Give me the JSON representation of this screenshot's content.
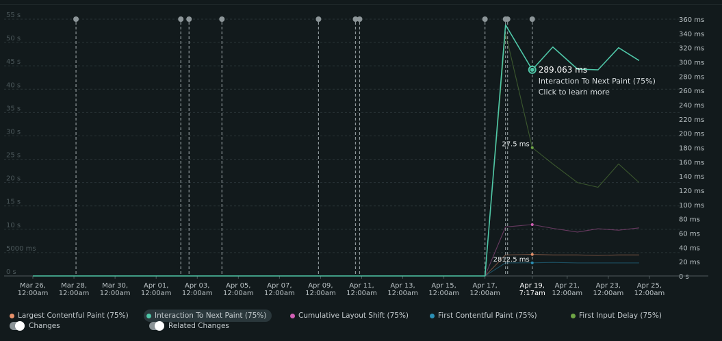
{
  "chart_data": {
    "type": "line",
    "x_ticks": [
      {
        "line1": "Mar 26,",
        "line2": "12:00am"
      },
      {
        "line1": "Mar 28,",
        "line2": "12:00am"
      },
      {
        "line1": "Mar 30,",
        "line2": "12:00am"
      },
      {
        "line1": "Apr 01,",
        "line2": "12:00am"
      },
      {
        "line1": "Apr 03,",
        "line2": "12:00am"
      },
      {
        "line1": "Apr 05,",
        "line2": "12:00am"
      },
      {
        "line1": "Apr 07,",
        "line2": "12:00am"
      },
      {
        "line1": "Apr 09,",
        "line2": "12:00am"
      },
      {
        "line1": "Apr 11,",
        "line2": "12:00am"
      },
      {
        "line1": "Apr 13,",
        "line2": "12:00am"
      },
      {
        "line1": "Apr 15,",
        "line2": "12:00am"
      },
      {
        "line1": "Apr 17,",
        "line2": "12:00am"
      },
      {
        "line1": "Apr 19,",
        "line2": "7:17am",
        "highlight": true
      },
      {
        "line1": "Apr 21,",
        "line2": "12:00am"
      },
      {
        "line1": "Apr 23,",
        "line2": "12:00am"
      },
      {
        "line1": "Apr 25,",
        "line2": "12:00am"
      }
    ],
    "x_tick_days": [
      0,
      2,
      4,
      6,
      8,
      10,
      12,
      14,
      16,
      18,
      20,
      22,
      24.3,
      26,
      28,
      30
    ],
    "left_axis": {
      "ticks": [
        "55 s",
        "50 s",
        "45 s",
        "40 s",
        "35 s",
        "30 s",
        "25 s",
        "20 s",
        "15 s",
        "10 s",
        "5000 ms",
        "0 s"
      ],
      "values": [
        55,
        50,
        45,
        40,
        35,
        30,
        25,
        20,
        15,
        10,
        5,
        0
      ],
      "ylim": [
        0,
        55
      ]
    },
    "right_axis": {
      "ticks": [
        "360 ms",
        "340 ms",
        "320 ms",
        "300 ms",
        "280 ms",
        "260 ms",
        "240 ms",
        "220 ms",
        "200 ms",
        "180 ms",
        "160 ms",
        "140 ms",
        "120 ms",
        "100 ms",
        "80 ms",
        "60 ms",
        "40 ms",
        "20 ms",
        "0 s"
      ],
      "values": [
        360,
        340,
        320,
        300,
        280,
        260,
        240,
        220,
        200,
        180,
        160,
        140,
        120,
        100,
        80,
        60,
        40,
        20,
        0
      ],
      "ylim": [
        0,
        360
      ]
    },
    "grid": true,
    "change_marker_days": [
      2.1,
      7.2,
      7.6,
      9.2,
      13.9,
      15.7,
      15.9,
      22.0,
      23.0,
      23.1,
      24.3
    ],
    "hover_day": 24.3,
    "series": [
      {
        "name": "Largest Contentful Paint (75%)",
        "color": "#e8916a",
        "axis": "left",
        "x": [
          0,
          22,
          23,
          24.3,
          25.3,
          26.5,
          27.5,
          28.5,
          29.5
        ],
        "y": [
          0,
          0,
          4.5,
          4.6,
          4.5,
          4.5,
          4.4,
          4.5,
          4.5
        ]
      },
      {
        "name": "Interaction To Next Paint (75%)",
        "color": "#4fc7a8",
        "axis": "right",
        "x": [
          0,
          22,
          23,
          24.3,
          25.3,
          26.5,
          27.5,
          28.5,
          29.5
        ],
        "y": [
          0,
          0,
          352,
          289.063,
          321,
          290,
          289,
          320,
          302
        ]
      },
      {
        "name": "Cumulative Layout Shift (75%)",
        "color": "#d05fb4",
        "axis": "left",
        "x": [
          0,
          22,
          23,
          24.3,
          25.3,
          26.5,
          27.5,
          28.5,
          29.5
        ],
        "y": [
          0,
          0,
          10.5,
          11,
          10.2,
          9.4,
          10.1,
          9.8,
          10.3
        ]
      },
      {
        "name": "First Contentful Paint (75%)",
        "color": "#2b8fb4",
        "axis": "left",
        "x": [
          0,
          22,
          23,
          24.3,
          25.3,
          26.5,
          27.5,
          28.5,
          29.5
        ],
        "y": [
          0,
          0,
          2.8,
          2.8125,
          2.9,
          2.8,
          2.8,
          2.8,
          2.8
        ]
      },
      {
        "name": "First Input Delay (75%)",
        "color": "#6ea545",
        "axis": "left",
        "x": [
          0,
          22,
          23,
          24.3,
          25.3,
          26.5,
          27.5,
          28.5,
          29.5
        ],
        "y": [
          0,
          0,
          52,
          27.5,
          24,
          20,
          19,
          24,
          20
        ]
      }
    ],
    "active_series": "Interaction To Next Paint (75%)",
    "tooltip": {
      "value": "289.063 ms",
      "series": "Interaction To Next Paint (75%)",
      "action": "Click to learn more"
    },
    "point_labels": [
      {
        "text": "27.5 ms",
        "series": "First Input Delay (75%)"
      },
      {
        "text": "2812.5 ms",
        "series": "First Contentful Paint (75%)"
      }
    ]
  },
  "legend": [
    {
      "label": "Largest Contentful Paint (75%)",
      "color": "#e8916a"
    },
    {
      "label": "Interaction To Next Paint (75%)",
      "color": "#4fc7a8",
      "active": true
    },
    {
      "label": "Cumulative Layout Shift (75%)",
      "color": "#d05fb4"
    },
    {
      "label": "First Contentful Paint (75%)",
      "color": "#2b8fb4"
    },
    {
      "label": "First Input Delay (75%)",
      "color": "#6ea545"
    }
  ],
  "toggles": [
    {
      "label": "Changes",
      "on": true
    },
    {
      "label": "Related Changes",
      "on": true
    }
  ]
}
